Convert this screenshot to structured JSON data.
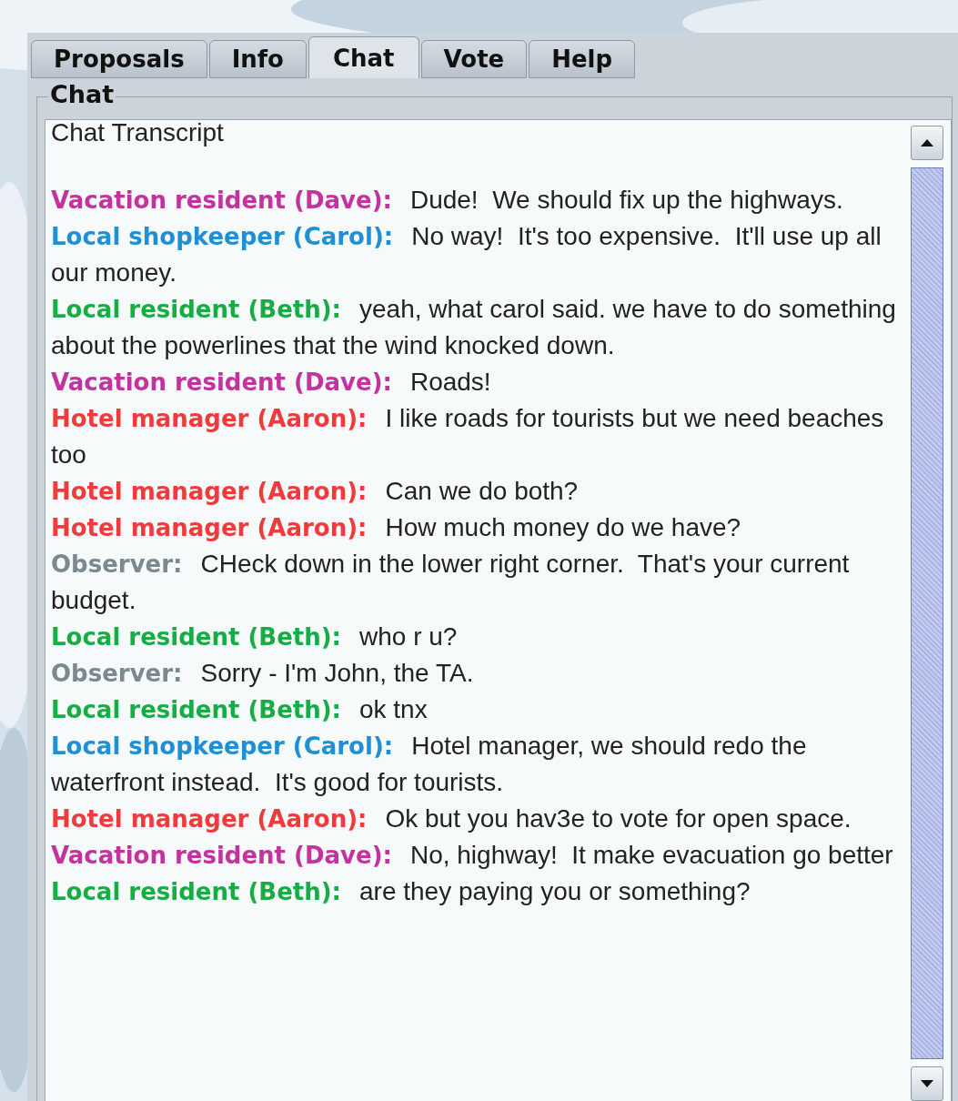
{
  "tabs": [
    {
      "label": "Proposals",
      "selected": false
    },
    {
      "label": "Info",
      "selected": false
    },
    {
      "label": "Chat",
      "selected": true
    },
    {
      "label": "Vote",
      "selected": false
    },
    {
      "label": "Help",
      "selected": false
    }
  ],
  "group_title": "Chat",
  "transcript": {
    "title": "Chat Transcript",
    "messages": [
      {
        "speaker": "Vacation resident (Dave):",
        "color": "#c2339f",
        "text": "Dude!  We should fix up the highways."
      },
      {
        "speaker": "Local shopkeeper (Carol):",
        "color": "#1f8fd6",
        "text": "No way!  It's too expensive.  It'll use up all our money."
      },
      {
        "speaker": "Local resident (Beth):",
        "color": "#17ad44",
        "text": "yeah, what carol said. we have to do something about the powerlines that the wind knocked down."
      },
      {
        "speaker": "Vacation resident (Dave):",
        "color": "#c2339f",
        "text": "Roads!"
      },
      {
        "speaker": "Hotel manager (Aaron):",
        "color": "#ef3b3b",
        "text": "I like roads for tourists but we need beaches too"
      },
      {
        "speaker": "Hotel manager (Aaron):",
        "color": "#ef3b3b",
        "text": "Can we do both?"
      },
      {
        "speaker": "Hotel manager (Aaron):",
        "color": "#ef3b3b",
        "text": "How much money do we have?"
      },
      {
        "speaker": "Observer:",
        "color": "#7b8a91",
        "text": "CHeck down in the lower right corner.  That's your current budget."
      },
      {
        "speaker": "Local resident (Beth):",
        "color": "#17ad44",
        "text": "who r u?"
      },
      {
        "speaker": "Observer:",
        "color": "#7b8a91",
        "text": "Sorry - I'm John, the TA."
      },
      {
        "speaker": "Local resident (Beth):",
        "color": "#17ad44",
        "text": "ok tnx"
      },
      {
        "speaker": "Local shopkeeper (Carol):",
        "color": "#1f8fd6",
        "text": "Hotel manager, we should redo the waterfront instead.  It's good for tourists."
      },
      {
        "speaker": "Hotel manager (Aaron):",
        "color": "#ef3b3b",
        "text": "Ok but you hav3e to vote for open space."
      },
      {
        "speaker": "Vacation resident (Dave):",
        "color": "#c2339f",
        "text": "No, highway!  It make evacuation go better"
      },
      {
        "speaker": "Local resident (Beth):",
        "color": "#17ad44",
        "text": "are they paying you or something?"
      }
    ]
  }
}
